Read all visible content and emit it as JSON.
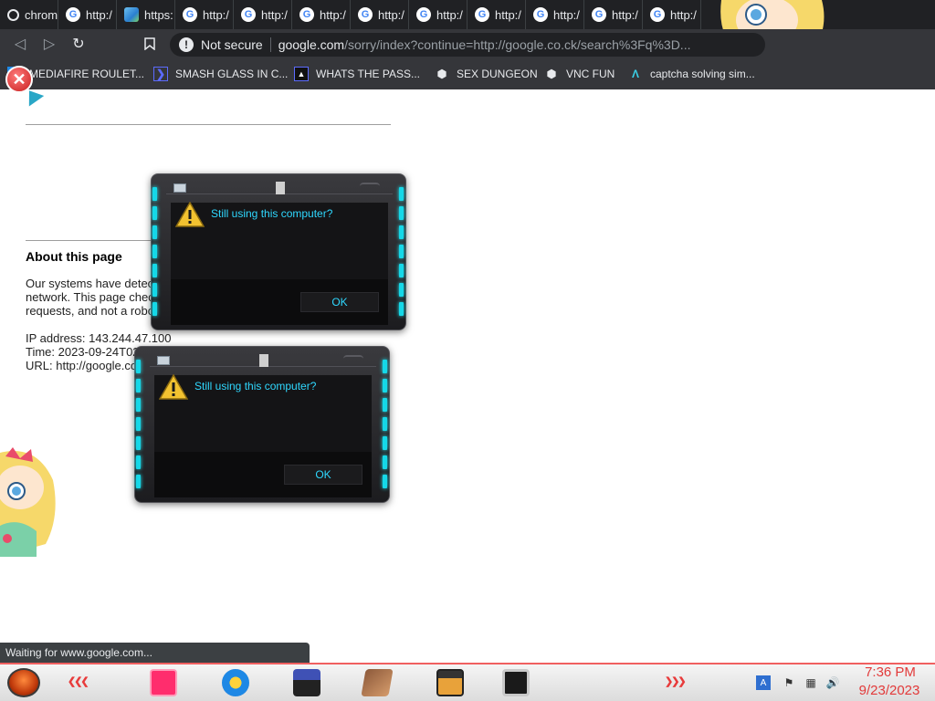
{
  "browser": {
    "tabs": [
      {
        "title": "chrom",
        "icon": "history-icon"
      },
      {
        "title": "http:/",
        "icon": "google-icon"
      },
      {
        "title": "https:",
        "icon": "image-icon"
      },
      {
        "title": "http:/",
        "icon": "google-icon"
      },
      {
        "title": "http:/",
        "icon": "google-icon"
      },
      {
        "title": "http:/",
        "icon": "google-icon"
      },
      {
        "title": "http:/",
        "icon": "google-icon"
      },
      {
        "title": "http:/",
        "icon": "google-icon"
      },
      {
        "title": "http:/",
        "icon": "google-icon"
      },
      {
        "title": "http:/",
        "icon": "google-icon"
      },
      {
        "title": "http:/",
        "icon": "google-icon"
      },
      {
        "title": "http:/",
        "icon": "google-icon"
      }
    ],
    "address": {
      "security_label": "Not secure",
      "host": "google.com",
      "path": "/sorry/index?continue=http://google.co.ck/search%3Fq%3D..."
    },
    "bookmarks": [
      {
        "label": "MEDIAFIRE ROULET...",
        "icon": "mediafire-icon"
      },
      {
        "label": "SMASH GLASS IN C...",
        "icon": "bookmark-icon"
      },
      {
        "label": "WHATS THE PASS...",
        "icon": "bookmark-icon"
      },
      {
        "label": "SEX DUNGEON",
        "icon": "cube-icon"
      },
      {
        "label": "VNC FUN",
        "icon": "cube-icon"
      },
      {
        "label": "captcha solving sim...",
        "icon": "arrow-icon"
      }
    ],
    "status_text": "Waiting for www.google.com..."
  },
  "page": {
    "about_heading": "About this page",
    "body_lines": [
      "Our systems have detec",
      "network. This page chec",
      "requests, and not a robo"
    ],
    "ip_line": "IP address: 143.244.47.100",
    "time_line": "Time: 2023-09-24T02",
    "url_line": "URL: http://google.co"
  },
  "dialogs": [
    {
      "message": "Still using this computer?",
      "ok_label": "OK"
    },
    {
      "message": "Still using this computer?",
      "ok_label": "OK"
    }
  ],
  "taskbar": {
    "clock_time": "7:36 PM",
    "clock_date": "9/23/2023",
    "accent_color": "#e23a3a"
  },
  "colors": {
    "dialog_text": "#2fd8ff",
    "dialog_led": "#15d8e8",
    "chrome_dark": "#202124"
  }
}
